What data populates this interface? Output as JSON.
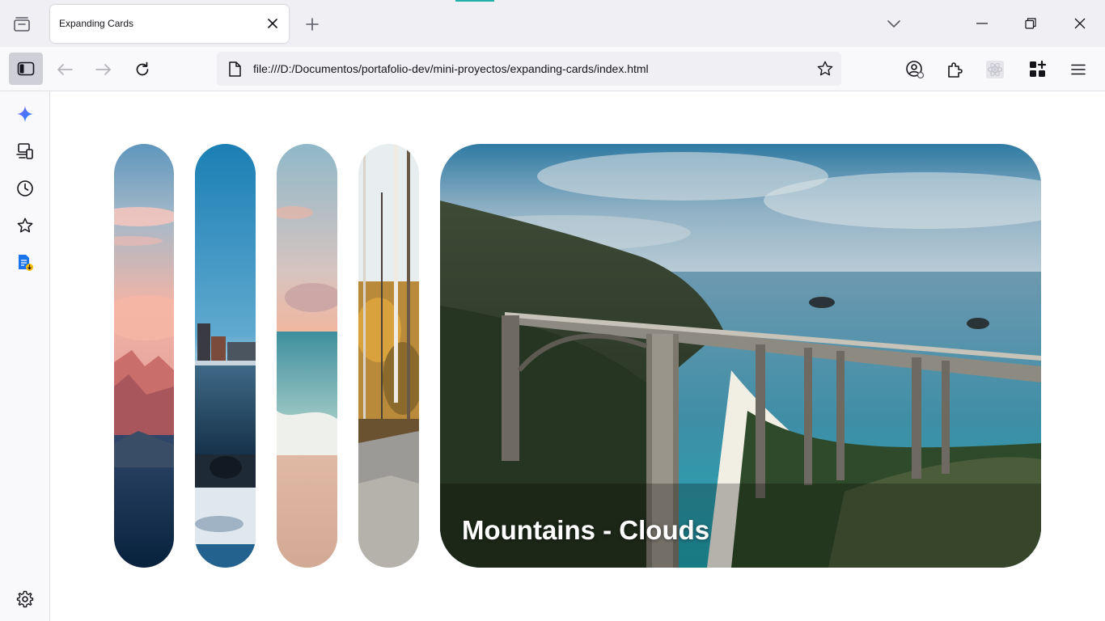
{
  "browser": {
    "tab": {
      "title": "Expanding Cards"
    },
    "address_bar": {
      "url": "file:///D:/Documentos/portafolio-dev/mini-proyectos/expanding-cards/index.html"
    },
    "colors": {
      "tab_accent": "#20b2aa",
      "chrome_bg": "#f0f0f4",
      "toolbar_bg": "#f9f9fb",
      "active_toggle": "#cfcfd8"
    },
    "icons": {
      "tab_strip": [
        "tab-list-icon",
        "close-icon",
        "plus-icon",
        "chevron-down-icon",
        "minimize-icon",
        "restore-icon",
        "window-close-icon"
      ],
      "nav": [
        "sidebar-toggle-icon",
        "back-arrow-icon",
        "forward-arrow-icon",
        "reload-icon",
        "page-icon",
        "star-icon"
      ],
      "toolbar": [
        "account-icon",
        "extensions-icon",
        "react-devtools-icon",
        "grid-plus-icon",
        "hamburger-menu-icon"
      ],
      "sidebar": [
        "ai-sparkle-icon",
        "synced-devices-icon",
        "history-icon",
        "bookmarks-star-icon",
        "doc-download-icon",
        "settings-gear-icon"
      ]
    }
  },
  "page": {
    "panels": [
      {
        "scene": "mountains-sunset",
        "active": false
      },
      {
        "scene": "city-waterfront",
        "active": false
      },
      {
        "scene": "beach-shore",
        "active": false
      },
      {
        "scene": "autumn-forest-path",
        "active": false
      },
      {
        "scene": "coastal-bridge",
        "active": true,
        "title": "Mountains - Clouds"
      }
    ]
  }
}
